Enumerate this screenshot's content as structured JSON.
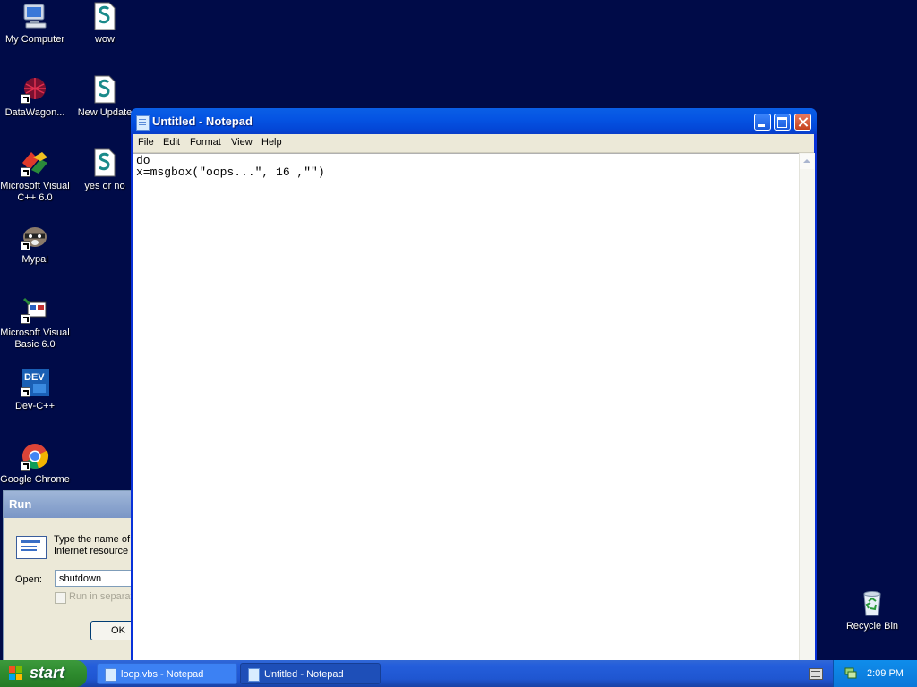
{
  "desktop": {
    "background": "#000b48",
    "icons": [
      {
        "label": "My Computer",
        "icon": "my-computer-icon"
      },
      {
        "label": "wow",
        "icon": "script-file-icon"
      },
      {
        "label": "DataWagon...",
        "icon": "datawagon-icon"
      },
      {
        "label": "New Update",
        "icon": "script-file-icon"
      },
      {
        "label": "Microsoft Visual C++ 6.0",
        "icon": "visual-cpp-icon"
      },
      {
        "label": "yes or no",
        "icon": "script-file-icon"
      },
      {
        "label": "Mypal",
        "icon": "mypal-raccoon-icon"
      },
      {
        "label": "Microsoft Visual Basic 6.0",
        "icon": "visual-basic-icon"
      },
      {
        "label": "Dev-C++",
        "icon": "devcpp-icon"
      },
      {
        "label": "Google Chrome",
        "icon": "chrome-icon"
      },
      {
        "label": "Recycle Bin",
        "icon": "recycle-bin-icon"
      }
    ]
  },
  "run_dialog": {
    "title": "Run",
    "description_line1": "Type the name of",
    "description_line2": "Internet resource",
    "open_label": "Open:",
    "open_value": "shutdown",
    "checkbox_label": "Run in separat",
    "ok_label": "OK"
  },
  "notepad": {
    "title": "Untitled - Notepad",
    "menu": [
      "File",
      "Edit",
      "Format",
      "View",
      "Help"
    ],
    "lines": [
      "do",
      "x=msgbox(\"oops...\", 16 ,\"\")"
    ]
  },
  "taskbar": {
    "start_label": "start",
    "tasks": [
      {
        "label": "loop.vbs - Notepad",
        "active": false
      },
      {
        "label": "Untitled - Notepad",
        "active": true
      }
    ],
    "clock": "2:09 PM"
  },
  "colors": {
    "titlebar_blue": "#0554e3",
    "taskbar_blue": "#245edb",
    "start_green": "#2e8b2e",
    "tray_blue": "#0f8deb"
  }
}
